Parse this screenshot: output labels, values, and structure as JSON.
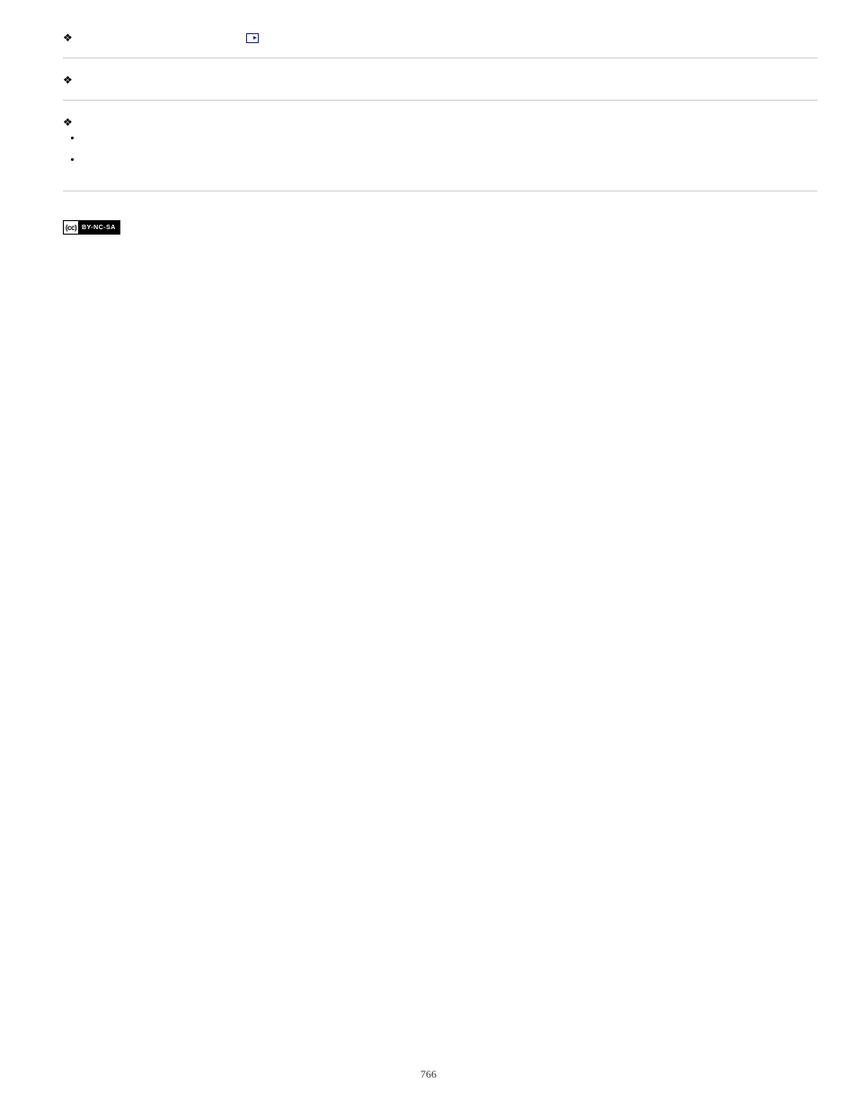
{
  "sections": [
    {
      "has_video_icon": true,
      "sub_bullets": []
    },
    {
      "has_video_icon": false,
      "sub_bullets": []
    },
    {
      "has_video_icon": false,
      "sub_bullets": [
        "",
        ""
      ]
    }
  ],
  "license": {
    "cc_label": "(cc)",
    "terms": "BY-NC-SA"
  },
  "page_number": "766"
}
